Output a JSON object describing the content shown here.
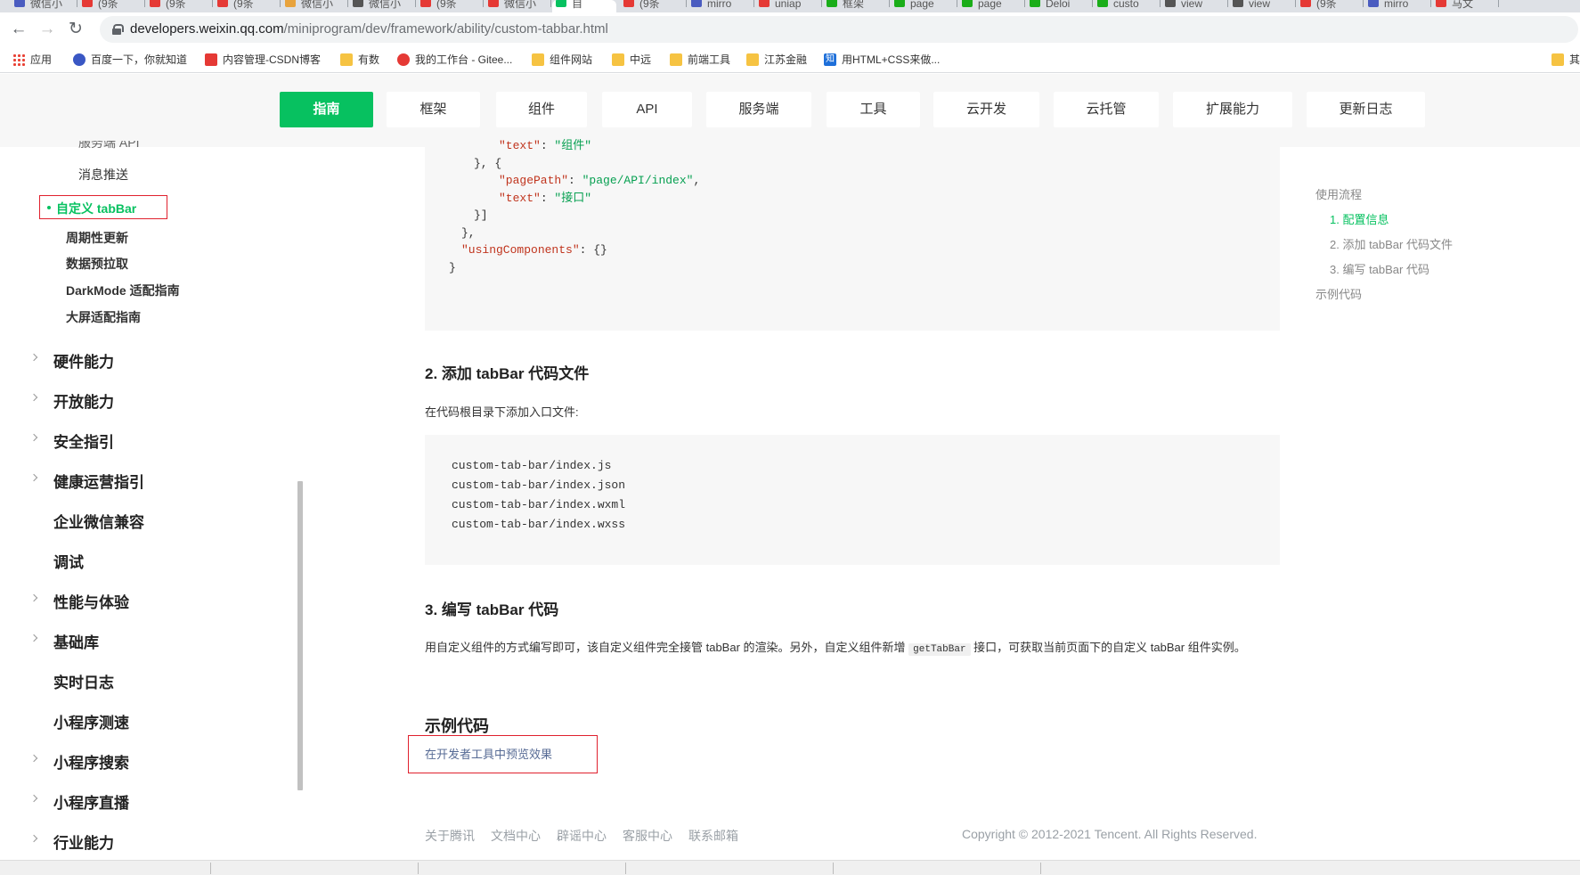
{
  "browser": {
    "tabs": [
      {
        "label": "微信小",
        "color": "#4a5cc0"
      },
      {
        "label": "(9条",
        "color": "#e53935"
      },
      {
        "label": "(9条",
        "color": "#e53935"
      },
      {
        "label": "(9条",
        "color": "#e53935"
      },
      {
        "label": "微信小",
        "color": "#e8a33d"
      },
      {
        "label": "微信小",
        "color": "#555555"
      },
      {
        "label": "(9条",
        "color": "#e53935"
      },
      {
        "label": "微信小",
        "color": "#e53935"
      },
      {
        "label": "自",
        "color": "#07c160",
        "active": true
      },
      {
        "label": "(9条",
        "color": "#e53935"
      },
      {
        "label": "mirro",
        "color": "#4a5cc0"
      },
      {
        "label": "uniap",
        "color": "#e53935"
      },
      {
        "label": "框架",
        "color": "#1aad19"
      },
      {
        "label": "page",
        "color": "#1aad19"
      },
      {
        "label": "page",
        "color": "#1aad19"
      },
      {
        "label": "Deloi",
        "color": "#1aad19"
      },
      {
        "label": "custo",
        "color": "#1aad19"
      },
      {
        "label": "view",
        "color": "#555555"
      },
      {
        "label": "view",
        "color": "#555555"
      },
      {
        "label": "(9条",
        "color": "#e53935"
      },
      {
        "label": "mirro",
        "color": "#4a5cc0"
      },
      {
        "label": "马文",
        "color": "#e53935"
      }
    ],
    "url_host": "developers.weixin.qq.com",
    "url_path": "/miniprogram/dev/framework/ability/custom-tabbar.html",
    "bookmarks": [
      {
        "label": "应用",
        "icon": "apps-grid-icon"
      },
      {
        "label": "百度一下，你就知道",
        "icon": "baidu-icon"
      },
      {
        "label": "内容管理-CSDN博客",
        "icon": "csdn-icon"
      },
      {
        "label": "有数",
        "icon": "folder-icon"
      },
      {
        "label": "我的工作台 - Gitee...",
        "icon": "gitee-icon"
      },
      {
        "label": "组件网站",
        "icon": "folder-icon"
      },
      {
        "label": "中远",
        "icon": "folder-icon"
      },
      {
        "label": "前端工具",
        "icon": "folder-icon"
      },
      {
        "label": "江苏金融",
        "icon": "folder-icon"
      },
      {
        "label": "用HTML+CSS来做...",
        "icon": "zhihu-icon"
      },
      {
        "label": "其",
        "icon": "folder-icon"
      }
    ]
  },
  "header": {
    "nav": [
      "指南",
      "框架",
      "组件",
      "API",
      "服务端",
      "工具",
      "云开发",
      "云托管",
      "扩展能力",
      "更新日志"
    ],
    "active_index": 0
  },
  "sidebar": {
    "cut_item": "服务端 API",
    "sub_items_top": [
      "消息推送"
    ],
    "active_item": "自定义 tabBar",
    "sub_items": [
      "周期性更新",
      "数据预拉取",
      "DarkMode 适配指南",
      "大屏适配指南"
    ],
    "top_items": [
      {
        "label": "硬件能力",
        "expandable": true
      },
      {
        "label": "开放能力",
        "expandable": true
      },
      {
        "label": "安全指引",
        "expandable": true
      },
      {
        "label": "健康运营指引",
        "expandable": true
      },
      {
        "label": "企业微信兼容",
        "expandable": false
      },
      {
        "label": "调试",
        "expandable": false
      },
      {
        "label": "性能与体验",
        "expandable": true
      },
      {
        "label": "基础库",
        "expandable": true
      },
      {
        "label": "实时日志",
        "expandable": false
      },
      {
        "label": "小程序测速",
        "expandable": false
      },
      {
        "label": "小程序搜索",
        "expandable": true
      },
      {
        "label": "小程序直播",
        "expandable": true
      },
      {
        "label": "行业能力",
        "expandable": true
      }
    ]
  },
  "content": {
    "code1": [
      {
        "indent": 2,
        "parts": [
          [
            "k",
            "\"text\""
          ],
          [
            "p",
            ": "
          ],
          [
            "s",
            "\"组件\""
          ]
        ]
      },
      {
        "indent": 1,
        "parts": [
          [
            "p",
            "}, {"
          ]
        ]
      },
      {
        "indent": 2,
        "parts": [
          [
            "k",
            "\"pagePath\""
          ],
          [
            "p",
            ": "
          ],
          [
            "s",
            "\"page/API/index\""
          ],
          [
            "p",
            ","
          ]
        ]
      },
      {
        "indent": 2,
        "parts": [
          [
            "k",
            "\"text\""
          ],
          [
            "p",
            ": "
          ],
          [
            "s",
            "\"接口\""
          ]
        ]
      },
      {
        "indent": 1,
        "parts": [
          [
            "p",
            "}]"
          ]
        ]
      },
      {
        "indent": 0.5,
        "parts": [
          [
            "p",
            "},"
          ]
        ]
      },
      {
        "indent": 0.5,
        "parts": [
          [
            "k",
            "\"usingComponents\""
          ],
          [
            "p",
            ": {}"
          ]
        ]
      },
      {
        "indent": 0,
        "parts": [
          [
            "p",
            "}"
          ]
        ]
      }
    ],
    "section2_title": "2. 添加 tabBar 代码文件",
    "section2_text": "在代码根目录下添加入口文件:",
    "code2": [
      "custom-tab-bar/index.js",
      "custom-tab-bar/index.json",
      "custom-tab-bar/index.wxml",
      "custom-tab-bar/index.wxss"
    ],
    "section3_title": "3. 编写 tabBar 代码",
    "section3_text_before": "用自定义组件的方式编写即可，该自定义组件完全接管 tabBar 的渲染。另外，自定义组件新增 ",
    "section3_code": "getTabBar",
    "section3_text_after": " 接口，可获取当前页面下的自定义 tabBar 组件实例。",
    "example_title": "示例代码",
    "preview_link": "在开发者工具中预览效果"
  },
  "footer": {
    "links": [
      "关于腾讯",
      "文档中心",
      "辟谣中心",
      "客服中心",
      "联系邮箱"
    ],
    "copyright": "Copyright © 2012-2021 Tencent. All Rights Reserved."
  },
  "toc": {
    "items": [
      {
        "label": "使用流程",
        "level": 0,
        "active": false
      },
      {
        "label": "1. 配置信息",
        "level": 1,
        "active": true
      },
      {
        "label": "2. 添加 tabBar 代码文件",
        "level": 1,
        "active": false
      },
      {
        "label": "3. 编写 tabBar 代码",
        "level": 1,
        "active": false
      },
      {
        "label": "示例代码",
        "level": 0,
        "active": false
      }
    ]
  }
}
